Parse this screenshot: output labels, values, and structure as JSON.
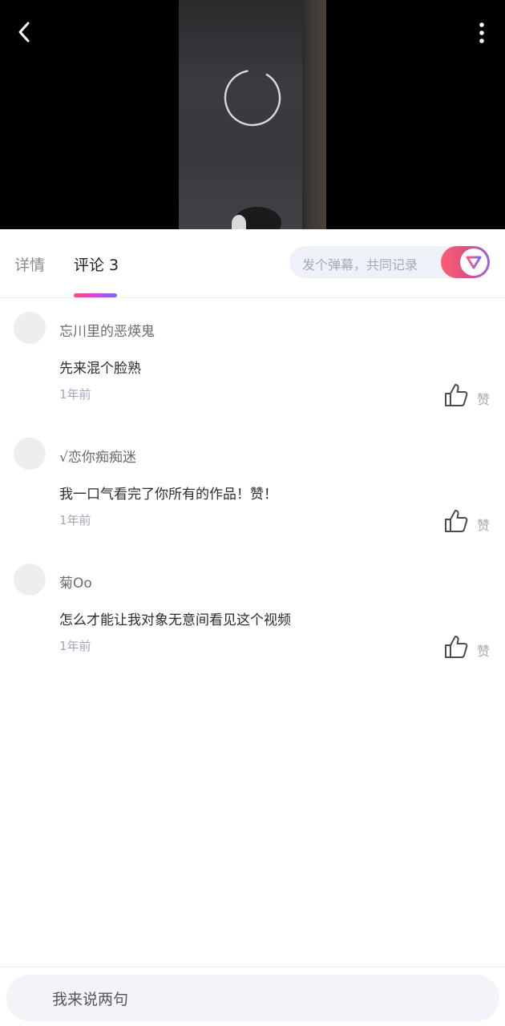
{
  "video": {
    "back_icon": "chevron-left-icon",
    "more_icon": "vertical-dots-icon",
    "loading_icon": "loading-spinner-icon"
  },
  "tabs": {
    "detail_label": "详情",
    "comments_label": "评论 3",
    "active": "comments"
  },
  "danmaku": {
    "placeholder": "发个弹幕，共同记录",
    "toggle_on": true,
    "toggle_icon": "danmaku-logo-icon"
  },
  "comments": [
    {
      "user": "忘川里的恶煐鬼",
      "text": "先来混个脸熟",
      "time": "1年前",
      "like_label": "赞"
    },
    {
      "user": "√恋你痴痴迷",
      "text": "我一口气看完了你所有的作品！赞！",
      "time": "1年前",
      "like_label": "赞"
    },
    {
      "user": "菊Oo",
      "text": "怎么才能让我对象无意间看见这个视频",
      "time": "1年前",
      "like_label": "赞"
    }
  ],
  "composer": {
    "placeholder": "我来说两句"
  },
  "colors": {
    "accent_gradient_start": "#ff4d7a",
    "accent_gradient_end": "#7a6bf0",
    "muted_text": "#a6a9b3"
  }
}
